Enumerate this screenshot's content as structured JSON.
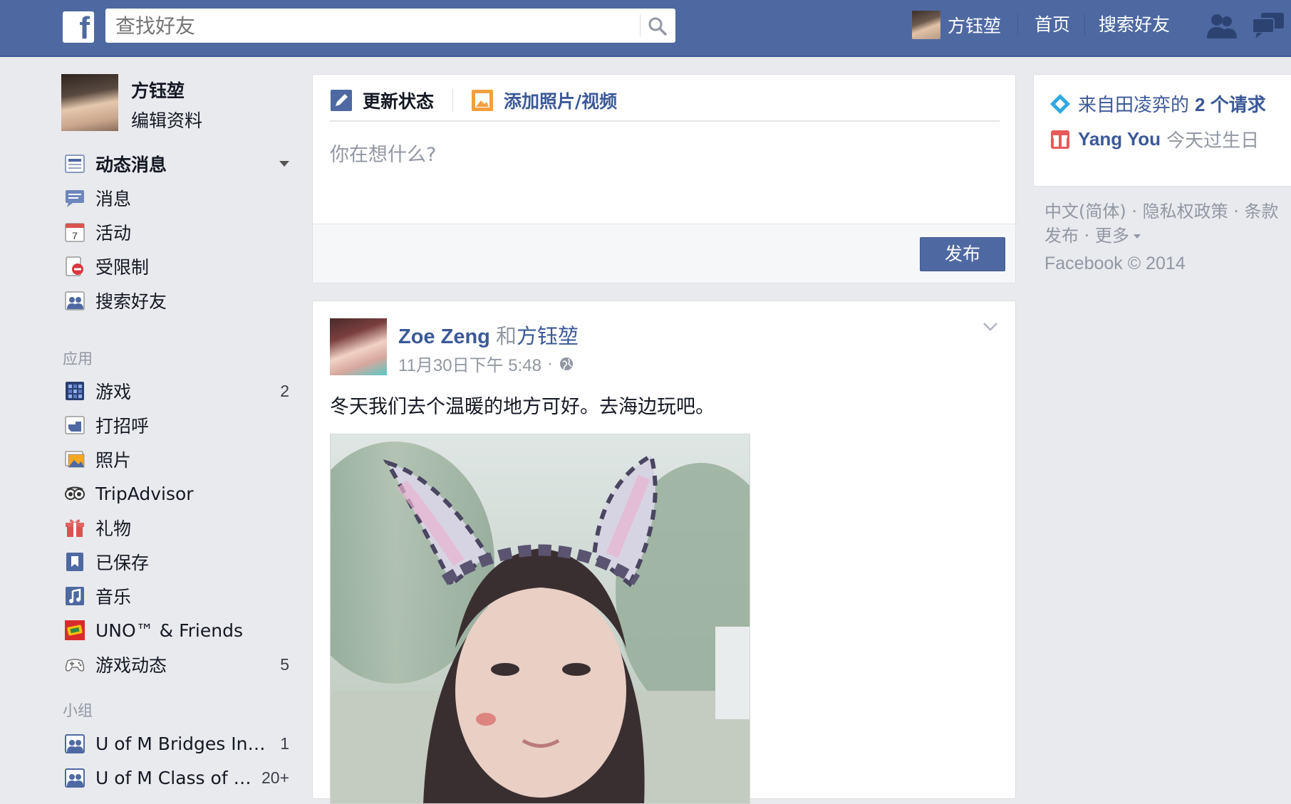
{
  "topbar": {
    "logo": "f",
    "search_placeholder": "查找好友",
    "user_name": "方钰堃",
    "home": "首页",
    "find_friends": "搜索好友"
  },
  "sidebar": {
    "profile_name": "方钰堃",
    "profile_edit": "编辑资料",
    "favorites": [
      {
        "label": "动态消息",
        "icon": "news-feed-icon"
      },
      {
        "label": "消息",
        "icon": "messages-icon"
      },
      {
        "label": "活动",
        "icon": "events-icon",
        "icon_text": "7"
      },
      {
        "label": "受限制",
        "icon": "restricted-icon"
      },
      {
        "label": "搜索好友",
        "icon": "find-friends-icon"
      }
    ],
    "apps_title": "应用",
    "apps": [
      {
        "label": "游戏",
        "count": "2",
        "icon": "games-icon"
      },
      {
        "label": "打招呼",
        "icon": "poke-icon"
      },
      {
        "label": "照片",
        "icon": "photos-icon"
      },
      {
        "label": "TripAdvisor",
        "icon": "tripadvisor-icon"
      },
      {
        "label": "礼物",
        "icon": "gifts-icon"
      },
      {
        "label": "已保存",
        "icon": "saved-icon"
      },
      {
        "label": "音乐",
        "icon": "music-icon"
      },
      {
        "label": "UNO™ & Friends",
        "icon": "uno-icon"
      },
      {
        "label": "游戏动态",
        "count": "5",
        "icon": "game-feed-icon"
      }
    ],
    "groups_title": "小组",
    "groups": [
      {
        "label": "U of M Bridges Int…",
        "count": "1",
        "icon": "group-icon"
      },
      {
        "label": "U of M Class of …",
        "count": "20+",
        "icon": "group-icon"
      }
    ]
  },
  "composer": {
    "tab_status": "更新状态",
    "tab_photo": "添加照片/视频",
    "placeholder": "你在想什么?",
    "post_button": "发布"
  },
  "post": {
    "author": "Zoe Zeng",
    "with_word": "和",
    "with_name": "方钰堃",
    "time": "11月30日下午 5:48",
    "separator": "·",
    "text": "冬天我们去个温暖的地方可好。去海边玩吧。"
  },
  "right": {
    "requests_prefix": "来自田凌弈的",
    "requests_count": "2 个请求",
    "birthday_name": "Yang You",
    "birthday_text": "今天过生日",
    "footer_line1": "中文(简体) · 隐私权政策 · 条款",
    "footer_line2": "发布 · 更多",
    "copyright": "Facebook © 2014"
  },
  "colors": {
    "topbar": "#4e69a2",
    "link": "#3b5998",
    "background": "#e9eaed"
  }
}
